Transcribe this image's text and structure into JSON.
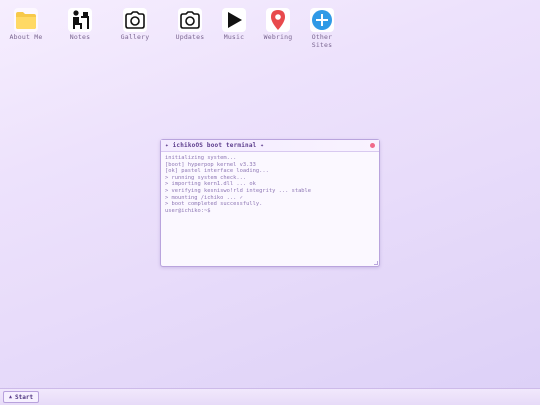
{
  "desktop": {
    "icons": [
      {
        "label": "About Me",
        "icon": "folder-icon"
      },
      {
        "label": "Notes",
        "icon": "person-at-desk-icon"
      },
      {
        "label": "Gallery",
        "icon": "camera-icon"
      },
      {
        "label": "Updates",
        "icon": "camera-icon"
      },
      {
        "label": "Music",
        "icon": "play-icon"
      },
      {
        "label": "Webring",
        "icon": "map-pin-icon"
      },
      {
        "label": "Other\nSites",
        "icon": "plus-circle-icon"
      }
    ]
  },
  "terminal": {
    "title": "✦ ichikoOS boot terminal ✦",
    "lines": [
      "initializing system...",
      "[boot] hyperpop kernel v3.33",
      "[ok] pastel interface loading...",
      "> running system check...",
      "> importing kern1.dll ... ok",
      "> verifying kesniswo!rld integrity ... stable",
      "> mounting /ichiko ... ✓",
      "> boot completed successfully.",
      "user@ichiko:~$"
    ]
  },
  "taskbar": {
    "start_label": "Start",
    "start_arrow": "▲"
  },
  "colors": {
    "accent": "#5c3c8c",
    "terminal_text": "#8d76b4",
    "close_dot": "#f06a8a",
    "pin_red": "#e8494c",
    "plus_blue": "#2f9ae6"
  }
}
